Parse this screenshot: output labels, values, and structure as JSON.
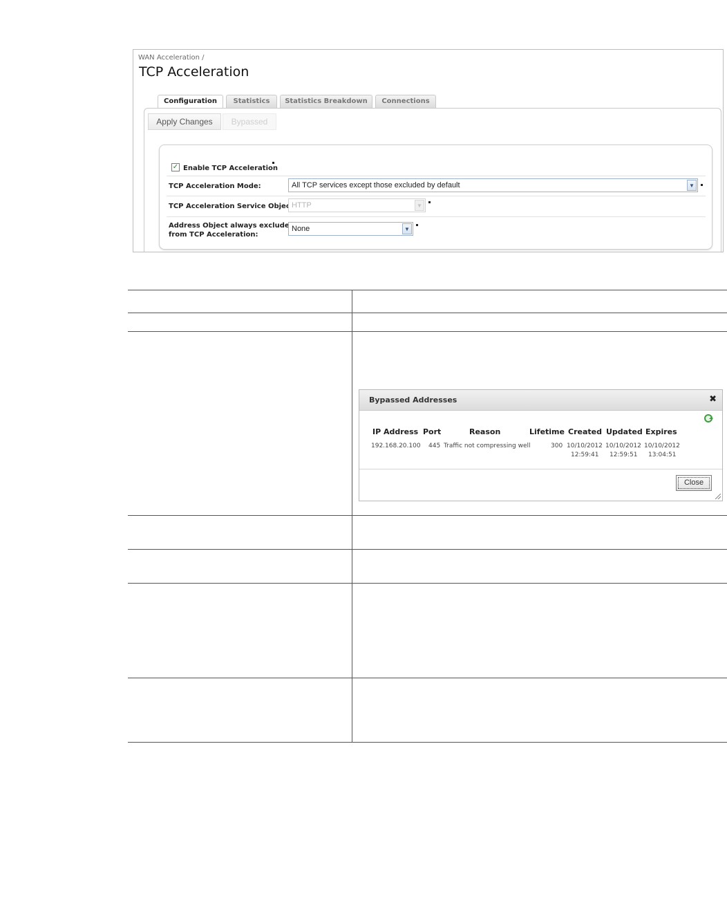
{
  "breadcrumb": "WAN Acceleration /",
  "title": "TCP Acceleration",
  "tabs": [
    {
      "label": "Configuration",
      "active": true
    },
    {
      "label": "Statistics",
      "active": false
    },
    {
      "label": "Statistics Breakdown",
      "active": false
    },
    {
      "label": "Connections",
      "active": false
    }
  ],
  "buttons": {
    "apply": "Apply Changes",
    "bypassed": "Bypassed"
  },
  "form": {
    "enable_label": "Enable TCP Acceleration",
    "enable_checked": true,
    "mode_label": "TCP Acceleration Mode:",
    "mode_value": "All TCP services except those excluded by default",
    "service_label": "TCP Acceleration Service Object:",
    "service_value": "HTTP",
    "address_label_line1": "Address Object always excluded",
    "address_label_line2": "from TCP Acceleration:",
    "address_value": "None"
  },
  "dialog": {
    "title": "Bypassed Addresses",
    "columns": [
      "IP Address",
      "Port",
      "Reason",
      "Lifetime",
      "Created",
      "Updated",
      "Expires"
    ],
    "rows": [
      {
        "ip": "192.168.20.100",
        "port": "445",
        "reason": "Traffic not compressing well",
        "lifetime": "300",
        "created": [
          "10/10/2012",
          "12:59:41"
        ],
        "updated": [
          "10/10/2012",
          "12:59:51"
        ],
        "expires": [
          "10/10/2012",
          "13:04:51"
        ]
      }
    ],
    "close_label": "Close"
  },
  "colors": {
    "checkmark": "#1f8b1f",
    "select_border": "#9fb4cc",
    "refresh": "#3f9c3f"
  }
}
